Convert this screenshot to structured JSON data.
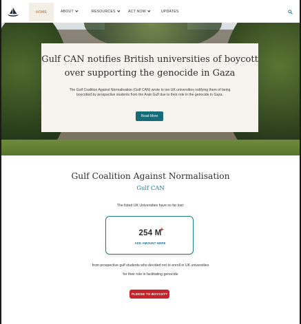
{
  "nav": {
    "items": [
      {
        "label": "HOME",
        "active": true
      },
      {
        "label": "ABOUT",
        "dropdown": true
      },
      {
        "label": "RESOURCES",
        "dropdown": true
      },
      {
        "label": "ACT NOW",
        "dropdown": true
      },
      {
        "label": "UPDATES",
        "dropdown": false
      }
    ],
    "search_icon": "search-icon",
    "logo_icon": "ship-logo-icon"
  },
  "hero": {
    "title": "Gulf CAN notifies British universities of boycott over supporting the genocide in Gaza",
    "text": "The Gulf Coalition Against Normalisation (Gulf CAN) wrote to ten UK universities notifying them of being boycotted by prospective students from the Arab Gulf due to their role in the genocide in Gaza.",
    "button_label": "Read More"
  },
  "org": {
    "title": "Gulf Coalition Against Normalisation",
    "subtitle": "Gulf CAN"
  },
  "counter": {
    "intro": "The listed UK Universities have so far lost:",
    "value": "254 M",
    "plus": "+",
    "add_label": "ADD AMOUNT HERE"
  },
  "footer_text": {
    "line1": "from prospective gulf students who decided not to enroll in UK universities",
    "line2": "for their role in facilitating genocide"
  },
  "pledge": {
    "button_label": "PLEDGE TO BOYCOTT"
  },
  "colors": {
    "accent_teal": "#176a77",
    "pledge_red": "#c8232a",
    "active_nav": "#b0672a"
  }
}
